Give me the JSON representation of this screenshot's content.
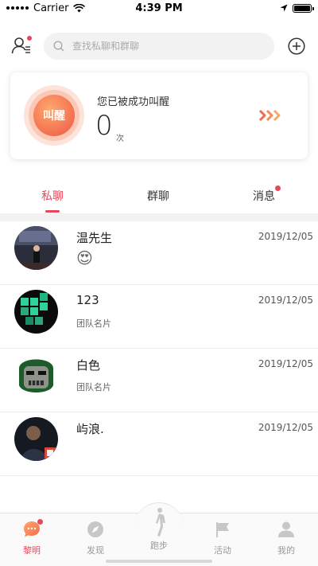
{
  "status_bar": {
    "carrier": "Carrier",
    "time": "4:39 PM"
  },
  "search": {
    "placeholder": "查找私聊和群聊"
  },
  "wake_card": {
    "button_label": "叫醒",
    "title": "您已被成功叫醒",
    "count": "0",
    "unit": "次"
  },
  "tabs": [
    {
      "label": "私聊",
      "active": true
    },
    {
      "label": "群聊",
      "active": false
    },
    {
      "label": "消息",
      "active": false,
      "has_badge": true
    }
  ],
  "chats": [
    {
      "name": "温先生",
      "time": "2019/12/05",
      "preview": "😍",
      "avatar": "person-on-stage-avatar"
    },
    {
      "name": "123",
      "time": "2019/12/05",
      "preview": "团队名片",
      "avatar": "green-blocks-avatar"
    },
    {
      "name": "白色",
      "time": "2019/12/05",
      "preview": "团队名片",
      "avatar": "masked-villain-avatar"
    },
    {
      "name": "屿浪.",
      "time": "2019/12/05",
      "preview": "",
      "avatar": "man-in-dark-avatar"
    }
  ],
  "bottom_nav": [
    {
      "label": "黎明",
      "icon": "chat-bubble-icon",
      "active": true,
      "has_badge": true
    },
    {
      "label": "发现",
      "icon": "compass-icon",
      "active": false
    },
    {
      "label": "跑步",
      "icon": "runner-icon",
      "active": false
    },
    {
      "label": "活动",
      "icon": "flag-icon",
      "active": false
    },
    {
      "label": "我的",
      "icon": "user-icon",
      "active": false
    }
  ],
  "colors": {
    "accent": "#e8475b",
    "wake_gradient_start": "#ffa86e",
    "wake_gradient_end": "#f26a4d"
  }
}
